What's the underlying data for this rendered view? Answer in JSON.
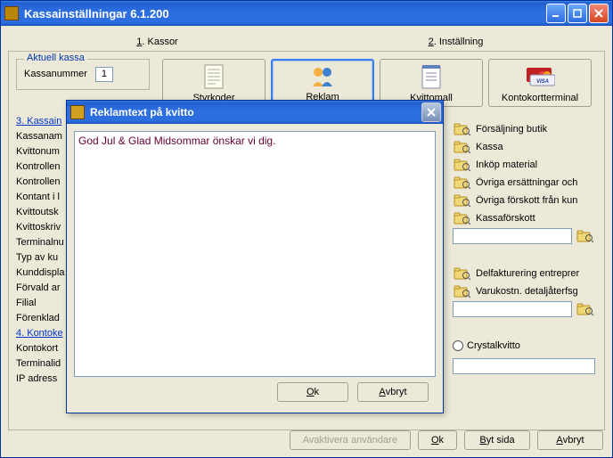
{
  "window": {
    "title": "Kassainställningar 6.1.200"
  },
  "tabs": {
    "t1": {
      "ul": "1",
      "rest": ". Kassor"
    },
    "t2": {
      "ul": "2",
      "rest": ". Inställning"
    }
  },
  "aktuell": {
    "legend": "Aktuell kassa",
    "label": "Kassanummer",
    "value": "1"
  },
  "bigButtons": {
    "b0": "Styrkoder",
    "b1": "Reklam",
    "b2": "Kvittomall",
    "b3": "Kontokortterminal"
  },
  "leftRows": {
    "r0": {
      "text": "3. Kassain",
      "link": true
    },
    "r1": {
      "text": "Kassanam"
    },
    "r2": {
      "text": "Kvittonum"
    },
    "r3": {
      "text": "Kontrollen"
    },
    "r4": {
      "text": "Kontrollen"
    },
    "r5": {
      "text": "Kontant i l"
    },
    "r6": {
      "text": "Kvittoutsk"
    },
    "r7": {
      "text": "Kvittoskriv"
    },
    "r8": {
      "text": "Terminalnu"
    },
    "r9": {
      "text": "Typ av ku"
    },
    "r10": {
      "text": "Kunddispla"
    },
    "r11": {
      "text": "Förvald ar"
    },
    "r12": {
      "text": "Filial"
    },
    "r13": {
      "text": "Förenklad"
    },
    "r14": {
      "text": "4. Kontoke",
      "link": true
    },
    "r15": {
      "text": "Kontokort"
    },
    "r16": {
      "text": "Terminalid"
    },
    "r17": {
      "text": "IP adress"
    }
  },
  "rightRows": {
    "r0": "Försäljning butik",
    "r1": "Kassa",
    "r2": "Inköp material",
    "r3": "Övriga ersättningar och",
    "r4": "Övriga förskott från kun",
    "r5": "Kassaförskott",
    "r6": "Delfakturering entreprer",
    "r7": "Varukostn. detaljåterfsg"
  },
  "radio": {
    "label": "Crystalkvitto"
  },
  "bottom": {
    "deactivate": "Avaktivera användare",
    "ok": {
      "ul": "O",
      "rest": "k"
    },
    "bytsida": {
      "ul": "B",
      "rest": "yt sida"
    },
    "avbryt": {
      "ul": "A",
      "rest": "vbryt"
    }
  },
  "modal": {
    "title": "Reklamtext på kvitto",
    "text": "God Jul & Glad Midsommar önskar vi dig.",
    "ok": {
      "ul": "O",
      "rest": "k"
    },
    "avbryt": {
      "ul": "A",
      "rest": "vbryt"
    }
  }
}
